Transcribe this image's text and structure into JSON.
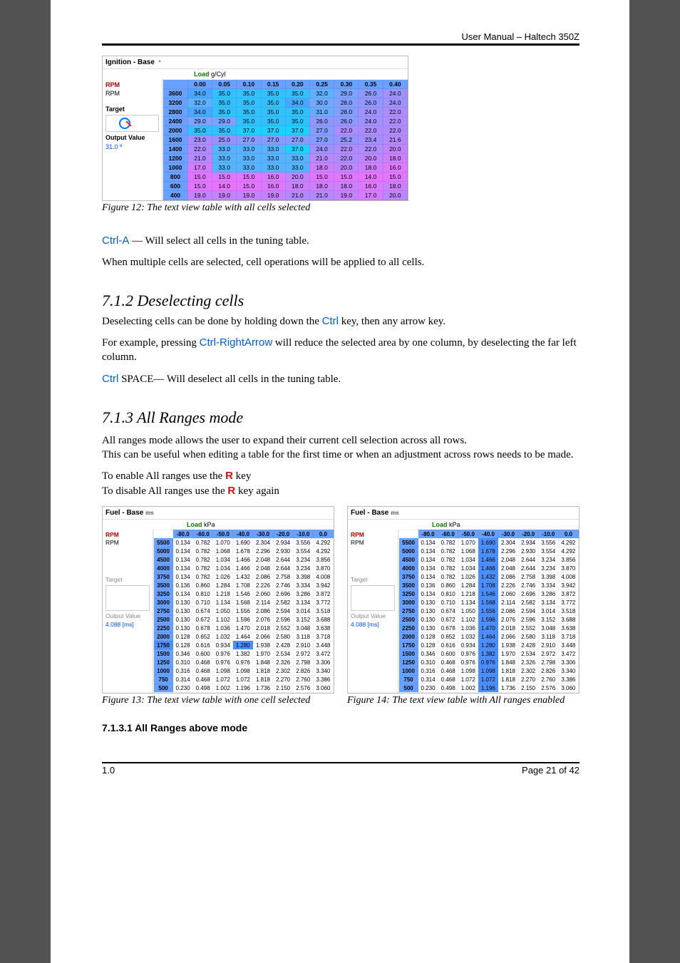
{
  "header": {
    "title": "User Manual – Haltech 350Z"
  },
  "figure12": {
    "window_title": "Ignition - Base",
    "unit_suffix": "º",
    "load_label": "Load",
    "load_unit": "g/Cyl",
    "side": {
      "rpm_red": "RPM",
      "rpm": "RPM",
      "target_label": "Target",
      "output_label": "Output Value",
      "output_value": "31.0 º"
    },
    "chart_data": {
      "type": "table",
      "title": "Ignition - Base (º)",
      "xlabel": "Load (g/Cyl)",
      "ylabel": "RPM",
      "columns": [
        "0.00",
        "0.05",
        "0.10",
        "0.15",
        "0.20",
        "0.25",
        "0.30",
        "0.35",
        "0.40"
      ],
      "rows": [
        "3600",
        "3200",
        "2800",
        "2400",
        "2000",
        "1600",
        "1400",
        "1200",
        "1000",
        "800",
        "600",
        "400"
      ],
      "values": [
        [
          34.0,
          35.0,
          35.0,
          35.0,
          35.0,
          32.0,
          29.0,
          26.0,
          24.0
        ],
        [
          32.0,
          35.0,
          35.0,
          35.0,
          34.0,
          30.0,
          28.0,
          26.0,
          24.0
        ],
        [
          34.0,
          35.0,
          35.0,
          35.0,
          35.0,
          31.0,
          28.0,
          24.0,
          22.0
        ],
        [
          29.0,
          29.0,
          35.0,
          35.0,
          35.0,
          26.0,
          26.0,
          24.0,
          22.0
        ],
        [
          35.0,
          35.0,
          37.0,
          37.0,
          37.0,
          27.0,
          22.0,
          22.0,
          22.0
        ],
        [
          23.0,
          25.0,
          27.0,
          27.0,
          27.0,
          27.0,
          25.2,
          23.4,
          21.6
        ],
        [
          22.0,
          33.0,
          33.0,
          33.0,
          37.0,
          24.0,
          22.0,
          22.0,
          20.0
        ],
        [
          21.0,
          33.0,
          33.0,
          33.0,
          33.0,
          21.0,
          22.0,
          20.0,
          18.0
        ],
        [
          17.0,
          33.0,
          33.0,
          33.0,
          33.0,
          18.0,
          20.0,
          18.0,
          16.0
        ],
        [
          15.0,
          15.0,
          15.0,
          16.0,
          20.0,
          15.0,
          15.0,
          14.0,
          15.0
        ],
        [
          15.0,
          14.0,
          15.0,
          16.0,
          18.0,
          18.0,
          18.0,
          16.0,
          18.0
        ],
        [
          19.0,
          19.0,
          19.0,
          19.0,
          21.0,
          21.0,
          19.0,
          17.0,
          20.0
        ]
      ],
      "colors": [
        [
          "#49a7ff",
          "#33c0ff",
          "#33c0ff",
          "#33c0ff",
          "#33c0ff",
          "#5fb0ff",
          "#7aa4ff",
          "#8f98ff",
          "#9f92ff"
        ],
        [
          "#5fb0ff",
          "#33c0ff",
          "#33c0ff",
          "#33c0ff",
          "#49a7ff",
          "#72a8ff",
          "#829eff",
          "#8f98ff",
          "#9f92ff"
        ],
        [
          "#49a7ff",
          "#33c0ff",
          "#33c0ff",
          "#33c0ff",
          "#33c0ff",
          "#69acfe",
          "#829eff",
          "#9f92ff",
          "#af8cfe"
        ],
        [
          "#7aa4ff",
          "#7aa4ff",
          "#33c0ff",
          "#33c0ff",
          "#33c0ff",
          "#8f98ff",
          "#8f98ff",
          "#9f92ff",
          "#af8cfe"
        ],
        [
          "#33c0ff",
          "#33c0ff",
          "#1dd0fe",
          "#1dd0fe",
          "#1dd0fe",
          "#879cff",
          "#af8cfe",
          "#af8cfe",
          "#af8cfe"
        ],
        [
          "#a78efe",
          "#9793fe",
          "#879cff",
          "#879cff",
          "#879cff",
          "#879cff",
          "#9394fe",
          "#a58ffe",
          "#b489fe"
        ],
        [
          "#af8cfe",
          "#57b3ff",
          "#57b3ff",
          "#57b3ff",
          "#1dd0fe",
          "#9f92ff",
          "#af8cfe",
          "#af8cfe",
          "#bf85fe"
        ],
        [
          "#b789fe",
          "#57b3ff",
          "#57b3ff",
          "#57b3ff",
          "#57b3ff",
          "#b789fe",
          "#af8cfe",
          "#bf85fe",
          "#cf7ffe"
        ],
        [
          "#d17efe",
          "#57b3ff",
          "#57b3ff",
          "#57b3ff",
          "#57b3ff",
          "#cb80fe",
          "#bf85fe",
          "#cf7ffe",
          "#df79fe"
        ],
        [
          "#e177fe",
          "#e177fe",
          "#e177fe",
          "#db7afe",
          "#bf85fe",
          "#e177fe",
          "#e177fe",
          "#e774fe",
          "#e177fe"
        ],
        [
          "#e177fe",
          "#e774fe",
          "#e177fe",
          "#db7afe",
          "#cb80fe",
          "#cb80fe",
          "#cb80fe",
          "#db7afe",
          "#cb80fe"
        ],
        [
          "#c582fe",
          "#c582fe",
          "#c582fe",
          "#c582fe",
          "#b589fe",
          "#b589fe",
          "#c582fe",
          "#d57cfe",
          "#bd85fe"
        ]
      ]
    },
    "caption": "Figure 12: The text view table with all cells selected"
  },
  "para1": {
    "ctrl_a": "Ctrl-A",
    "rest": " — Will select all cells in the tuning table."
  },
  "para2": "When multiple cells are selected, cell operations will be applied to all cells.",
  "section712": {
    "heading": "7.1.2 Deselecting cells",
    "line1a": "Deselecting cells can be done by holding down the ",
    "ctrl": "Ctrl",
    "line1b": "  key, then any arrow key.",
    "line2a": "For example, pressing ",
    "ctrl_right": "Ctrl-RightArrow",
    "line2b": " will reduce the selected area by one column, by deselecting the far left column.",
    "line3a_kbd": "Ctrl",
    "line3b": " SPACE— Will deselect all cells in the tuning table."
  },
  "section713": {
    "heading": "7.1.3 All Ranges mode",
    "p1": "All ranges mode allows the user to expand their current cell selection across all rows.",
    "p2": "This can be useful when editing a table for the first time or when an adjustment across rows needs to be made.",
    "enable_a": "To enable All ranges use the ",
    "key": "R",
    "enable_b": " key",
    "disable_a": "To disable All ranges use the ",
    "disable_b": " key again"
  },
  "fuel": {
    "window_title": "Fuel - Base",
    "unit_suffix": "ms",
    "load_label": "Load",
    "load_unit": "kPa",
    "side": {
      "rpm_red": "RPM",
      "rpm": "RPM",
      "target_label": "Target",
      "output_label": "Output Value",
      "output_value": "4.088 [ms]"
    },
    "chart_data": {
      "type": "table",
      "title": "Fuel - Base (ms)",
      "xlabel": "Load (kPa)",
      "ylabel": "RPM",
      "columns": [
        "-80.0",
        "-60.0",
        "-50.0",
        "-40.0",
        "-30.0",
        "-20.0",
        "-10.0",
        "0.0"
      ],
      "rows": [
        "5500",
        "5000",
        "4500",
        "4000",
        "3750",
        "3500",
        "3250",
        "3000",
        "2750",
        "2500",
        "2250",
        "2000",
        "1750",
        "1500",
        "1250",
        "1000",
        "750",
        "500"
      ],
      "values": [
        [
          0.134,
          0.782,
          1.07,
          1.69,
          2.304,
          2.934,
          3.556,
          4.292
        ],
        [
          0.134,
          0.782,
          1.068,
          1.678,
          2.296,
          2.93,
          3.554,
          4.292
        ],
        [
          0.134,
          0.782,
          1.034,
          1.466,
          2.048,
          2.644,
          3.234,
          3.856
        ],
        [
          0.134,
          0.782,
          1.034,
          1.466,
          2.048,
          2.644,
          3.234,
          3.87
        ],
        [
          0.134,
          0.782,
          1.026,
          1.432,
          2.086,
          2.758,
          3.398,
          4.008
        ],
        [
          0.136,
          0.86,
          1.284,
          1.708,
          2.226,
          2.746,
          3.334,
          3.942
        ],
        [
          0.134,
          0.81,
          1.218,
          1.546,
          2.06,
          2.696,
          3.286,
          3.872
        ],
        [
          0.13,
          0.71,
          1.134,
          1.568,
          2.114,
          2.582,
          3.134,
          3.772
        ],
        [
          0.13,
          0.674,
          1.05,
          1.556,
          2.086,
          2.594,
          3.014,
          3.518
        ],
        [
          0.13,
          0.672,
          1.102,
          1.596,
          2.076,
          2.596,
          3.152,
          3.688
        ],
        [
          0.13,
          0.678,
          1.036,
          1.47,
          2.018,
          2.552,
          3.048,
          3.638
        ],
        [
          0.128,
          0.652,
          1.032,
          1.464,
          2.066,
          2.58,
          3.118,
          3.718
        ],
        [
          0.128,
          0.616,
          0.934,
          1.28,
          1.938,
          2.428,
          2.91,
          3.448
        ],
        [
          0.346,
          0.6,
          0.976,
          1.382,
          1.97,
          2.534,
          2.972,
          3.472
        ],
        [
          0.31,
          0.468,
          0.976,
          0.976,
          1.848,
          2.326,
          2.798,
          3.306
        ],
        [
          0.316,
          0.468,
          1.098,
          1.098,
          1.818,
          2.302,
          2.826,
          3.34
        ],
        [
          0.314,
          0.468,
          1.072,
          1.072,
          1.818,
          2.27,
          2.76,
          3.386
        ],
        [
          0.23,
          0.498,
          1.002,
          1.196,
          1.736,
          2.15,
          2.576,
          3.06
        ]
      ]
    },
    "single_highlight": {
      "row": 12,
      "col": 3
    },
    "column_highlight_col": 3
  },
  "figure13_caption": "Figure 13: The text view table with one cell selected",
  "figure14_caption": "Figure 14: The text view table with All ranges enabled",
  "subhead_7131": "7.1.3.1 All Ranges above mode",
  "footer": {
    "left": "1.0",
    "right": "Page 21 of 42"
  }
}
